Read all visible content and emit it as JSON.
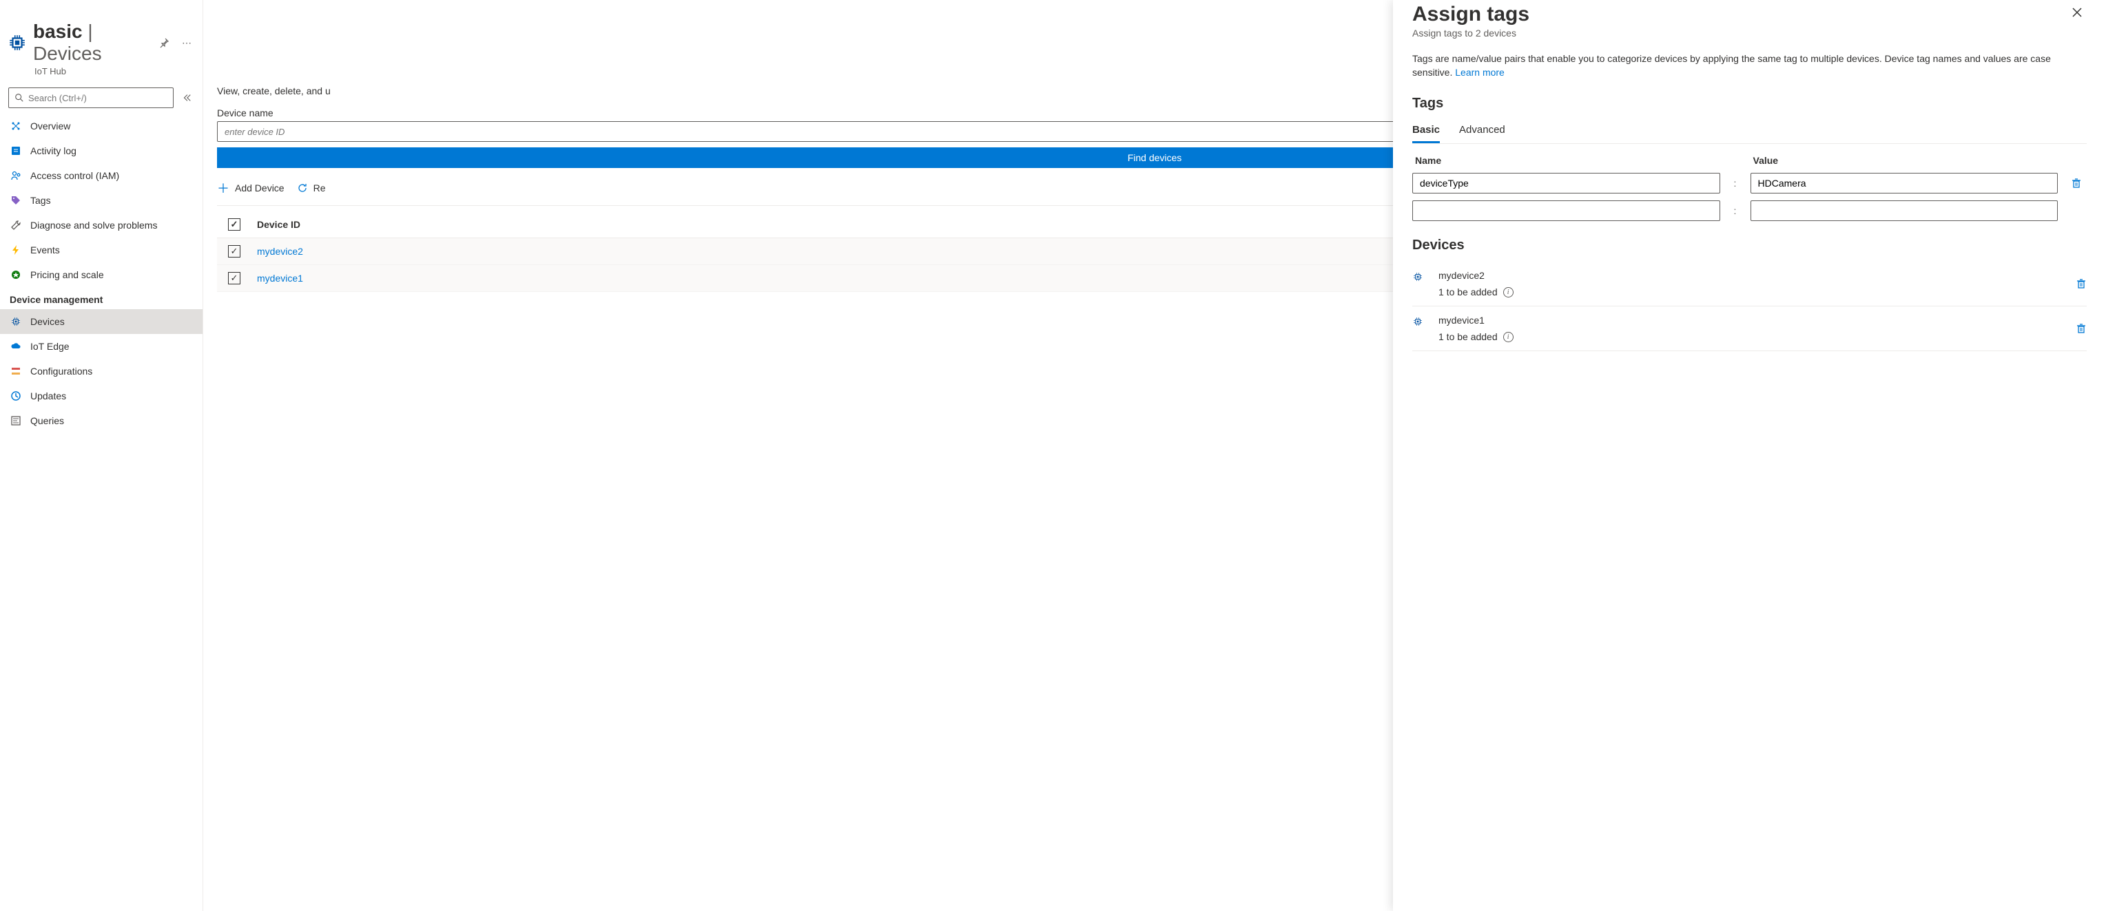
{
  "header": {
    "title_main": "basic",
    "title_sep": " | ",
    "title_sub": "Devices",
    "resource_type": "IoT Hub"
  },
  "search": {
    "placeholder": "Search (Ctrl+/)"
  },
  "nav": {
    "items_top": [
      {
        "label": "Overview",
        "icon": "overview"
      },
      {
        "label": "Activity log",
        "icon": "log"
      },
      {
        "label": "Access control (IAM)",
        "icon": "iam"
      },
      {
        "label": "Tags",
        "icon": "tag"
      },
      {
        "label": "Diagnose and solve problems",
        "icon": "wrench"
      },
      {
        "label": "Events",
        "icon": "bolt"
      },
      {
        "label": "Pricing and scale",
        "icon": "price"
      }
    ],
    "section1": "Device management",
    "items_dm": [
      {
        "label": "Devices",
        "icon": "chip",
        "active": true
      },
      {
        "label": "IoT Edge",
        "icon": "cloud"
      },
      {
        "label": "Configurations",
        "icon": "config"
      },
      {
        "label": "Updates",
        "icon": "update"
      },
      {
        "label": "Queries",
        "icon": "query"
      }
    ]
  },
  "main": {
    "description": "View, create, delete, and u",
    "device_name_label": "Device name",
    "device_name_placeholder": "enter device ID",
    "find_button": "Find devices",
    "toolbar": {
      "add": "Add Device",
      "refresh": "Re"
    },
    "table": {
      "header": "Device ID",
      "rows": [
        "mydevice2",
        "mydevice1"
      ]
    }
  },
  "panel": {
    "title": "Assign tags",
    "subtitle": "Assign tags to 2 devices",
    "description": "Tags are name/value pairs that enable you to categorize devices by applying the same tag to multiple devices. Device tag names and values are case sensitive. ",
    "learn_more": "Learn more",
    "tags_heading": "Tags",
    "tabs": {
      "basic": "Basic",
      "advanced": "Advanced"
    },
    "columns": {
      "name": "Name",
      "value": "Value"
    },
    "rows": [
      {
        "name": "deviceType",
        "value": "HDCamera",
        "deletable": true
      },
      {
        "name": "",
        "value": "",
        "deletable": false
      }
    ],
    "devices_heading": "Devices",
    "devices": [
      {
        "name": "mydevice2",
        "status": "1 to be added"
      },
      {
        "name": "mydevice1",
        "status": "1 to be added"
      }
    ]
  }
}
